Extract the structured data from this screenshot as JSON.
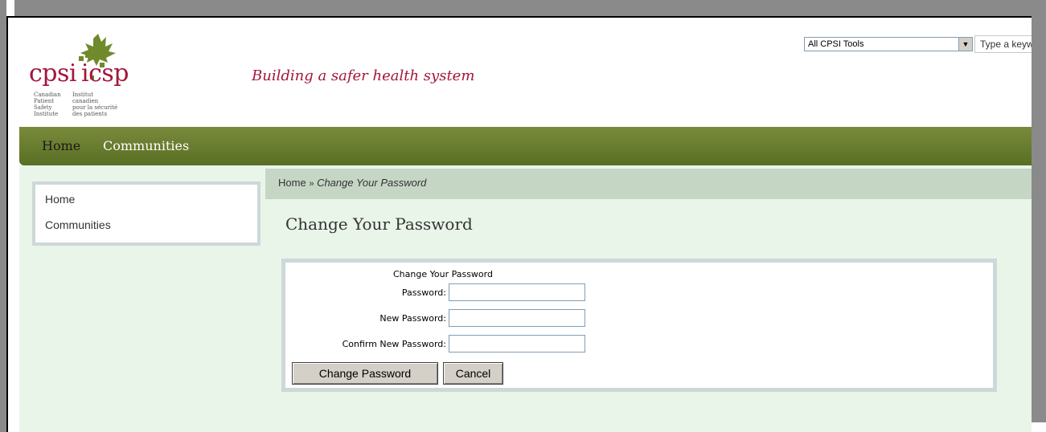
{
  "header": {
    "logo": {
      "name_en": "cpsi",
      "name_fr": "icsp",
      "lines_en": [
        "Canadian",
        "Patient",
        "Safety",
        "Institute"
      ],
      "lines_fr": [
        "Institut",
        "canadien",
        "pour la sécurité",
        "des patients"
      ],
      "colors": {
        "text": "#a4163b",
        "leaf": "#6f8a2a"
      }
    },
    "tagline": "Building a safer health system",
    "search": {
      "scope": "All CPSI Tools",
      "placeholder": "Type a keyw"
    }
  },
  "nav": {
    "items": [
      {
        "label": "Home"
      },
      {
        "label": "Communities"
      }
    ]
  },
  "sidebar": {
    "items": [
      {
        "label": "Home"
      },
      {
        "label": "Communities"
      }
    ]
  },
  "breadcrumb": {
    "home": "Home",
    "separator": "»",
    "current": "Change Your Password"
  },
  "page_title": "Change Your Password",
  "form": {
    "caption": "Change Your Password",
    "fields": [
      {
        "label": "Password:",
        "value": ""
      },
      {
        "label": "New Password:",
        "value": ""
      },
      {
        "label": "Confirm New Password:",
        "value": ""
      }
    ],
    "submit_label": "Change Password",
    "cancel_label": "Cancel"
  },
  "colors": {
    "nav_green": "#667a2d",
    "content_bg": "#eaf5ea",
    "breadcrumb_bg": "#c5d6c5",
    "panel_border": "#cdd8d8",
    "brand_red": "#a4163b"
  }
}
